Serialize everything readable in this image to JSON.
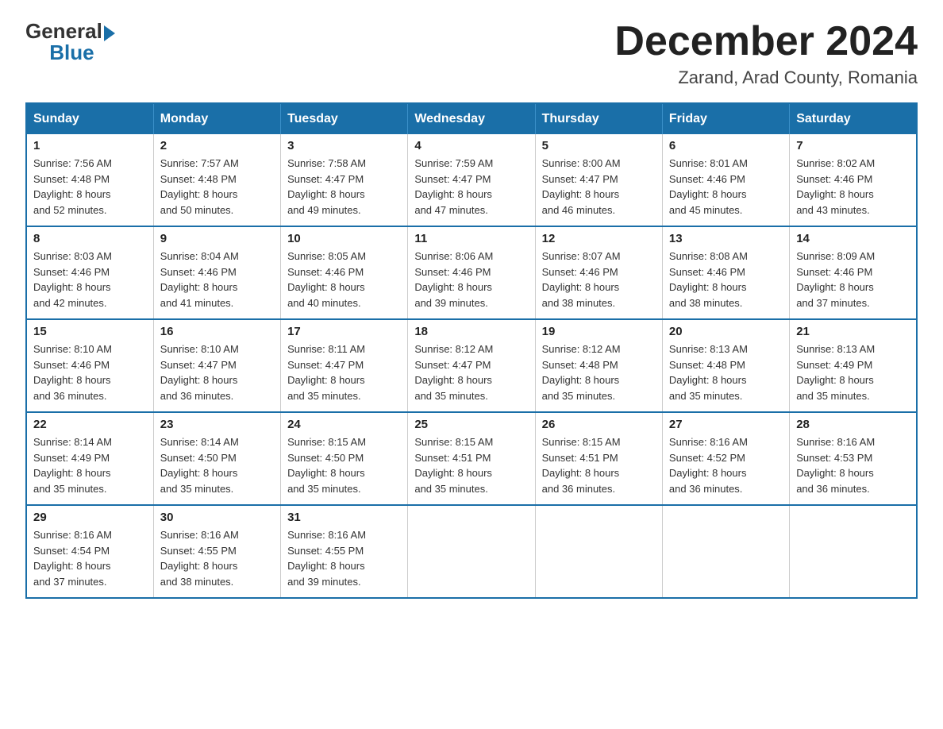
{
  "header": {
    "logo_general": "General",
    "logo_blue": "Blue",
    "main_title": "December 2024",
    "subtitle": "Zarand, Arad County, Romania"
  },
  "weekdays": [
    "Sunday",
    "Monday",
    "Tuesday",
    "Wednesday",
    "Thursday",
    "Friday",
    "Saturday"
  ],
  "weeks": [
    [
      {
        "day": "1",
        "sunrise": "7:56 AM",
        "sunset": "4:48 PM",
        "daylight": "8 hours and 52 minutes."
      },
      {
        "day": "2",
        "sunrise": "7:57 AM",
        "sunset": "4:48 PM",
        "daylight": "8 hours and 50 minutes."
      },
      {
        "day": "3",
        "sunrise": "7:58 AM",
        "sunset": "4:47 PM",
        "daylight": "8 hours and 49 minutes."
      },
      {
        "day": "4",
        "sunrise": "7:59 AM",
        "sunset": "4:47 PM",
        "daylight": "8 hours and 47 minutes."
      },
      {
        "day": "5",
        "sunrise": "8:00 AM",
        "sunset": "4:47 PM",
        "daylight": "8 hours and 46 minutes."
      },
      {
        "day": "6",
        "sunrise": "8:01 AM",
        "sunset": "4:46 PM",
        "daylight": "8 hours and 45 minutes."
      },
      {
        "day": "7",
        "sunrise": "8:02 AM",
        "sunset": "4:46 PM",
        "daylight": "8 hours and 43 minutes."
      }
    ],
    [
      {
        "day": "8",
        "sunrise": "8:03 AM",
        "sunset": "4:46 PM",
        "daylight": "8 hours and 42 minutes."
      },
      {
        "day": "9",
        "sunrise": "8:04 AM",
        "sunset": "4:46 PM",
        "daylight": "8 hours and 41 minutes."
      },
      {
        "day": "10",
        "sunrise": "8:05 AM",
        "sunset": "4:46 PM",
        "daylight": "8 hours and 40 minutes."
      },
      {
        "day": "11",
        "sunrise": "8:06 AM",
        "sunset": "4:46 PM",
        "daylight": "8 hours and 39 minutes."
      },
      {
        "day": "12",
        "sunrise": "8:07 AM",
        "sunset": "4:46 PM",
        "daylight": "8 hours and 38 minutes."
      },
      {
        "day": "13",
        "sunrise": "8:08 AM",
        "sunset": "4:46 PM",
        "daylight": "8 hours and 38 minutes."
      },
      {
        "day": "14",
        "sunrise": "8:09 AM",
        "sunset": "4:46 PM",
        "daylight": "8 hours and 37 minutes."
      }
    ],
    [
      {
        "day": "15",
        "sunrise": "8:10 AM",
        "sunset": "4:46 PM",
        "daylight": "8 hours and 36 minutes."
      },
      {
        "day": "16",
        "sunrise": "8:10 AM",
        "sunset": "4:47 PM",
        "daylight": "8 hours and 36 minutes."
      },
      {
        "day": "17",
        "sunrise": "8:11 AM",
        "sunset": "4:47 PM",
        "daylight": "8 hours and 35 minutes."
      },
      {
        "day": "18",
        "sunrise": "8:12 AM",
        "sunset": "4:47 PM",
        "daylight": "8 hours and 35 minutes."
      },
      {
        "day": "19",
        "sunrise": "8:12 AM",
        "sunset": "4:48 PM",
        "daylight": "8 hours and 35 minutes."
      },
      {
        "day": "20",
        "sunrise": "8:13 AM",
        "sunset": "4:48 PM",
        "daylight": "8 hours and 35 minutes."
      },
      {
        "day": "21",
        "sunrise": "8:13 AM",
        "sunset": "4:49 PM",
        "daylight": "8 hours and 35 minutes."
      }
    ],
    [
      {
        "day": "22",
        "sunrise": "8:14 AM",
        "sunset": "4:49 PM",
        "daylight": "8 hours and 35 minutes."
      },
      {
        "day": "23",
        "sunrise": "8:14 AM",
        "sunset": "4:50 PM",
        "daylight": "8 hours and 35 minutes."
      },
      {
        "day": "24",
        "sunrise": "8:15 AM",
        "sunset": "4:50 PM",
        "daylight": "8 hours and 35 minutes."
      },
      {
        "day": "25",
        "sunrise": "8:15 AM",
        "sunset": "4:51 PM",
        "daylight": "8 hours and 35 minutes."
      },
      {
        "day": "26",
        "sunrise": "8:15 AM",
        "sunset": "4:51 PM",
        "daylight": "8 hours and 36 minutes."
      },
      {
        "day": "27",
        "sunrise": "8:16 AM",
        "sunset": "4:52 PM",
        "daylight": "8 hours and 36 minutes."
      },
      {
        "day": "28",
        "sunrise": "8:16 AM",
        "sunset": "4:53 PM",
        "daylight": "8 hours and 36 minutes."
      }
    ],
    [
      {
        "day": "29",
        "sunrise": "8:16 AM",
        "sunset": "4:54 PM",
        "daylight": "8 hours and 37 minutes."
      },
      {
        "day": "30",
        "sunrise": "8:16 AM",
        "sunset": "4:55 PM",
        "daylight": "8 hours and 38 minutes."
      },
      {
        "day": "31",
        "sunrise": "8:16 AM",
        "sunset": "4:55 PM",
        "daylight": "8 hours and 39 minutes."
      },
      null,
      null,
      null,
      null
    ]
  ],
  "labels": {
    "sunrise": "Sunrise:",
    "sunset": "Sunset:",
    "daylight": "Daylight:"
  }
}
